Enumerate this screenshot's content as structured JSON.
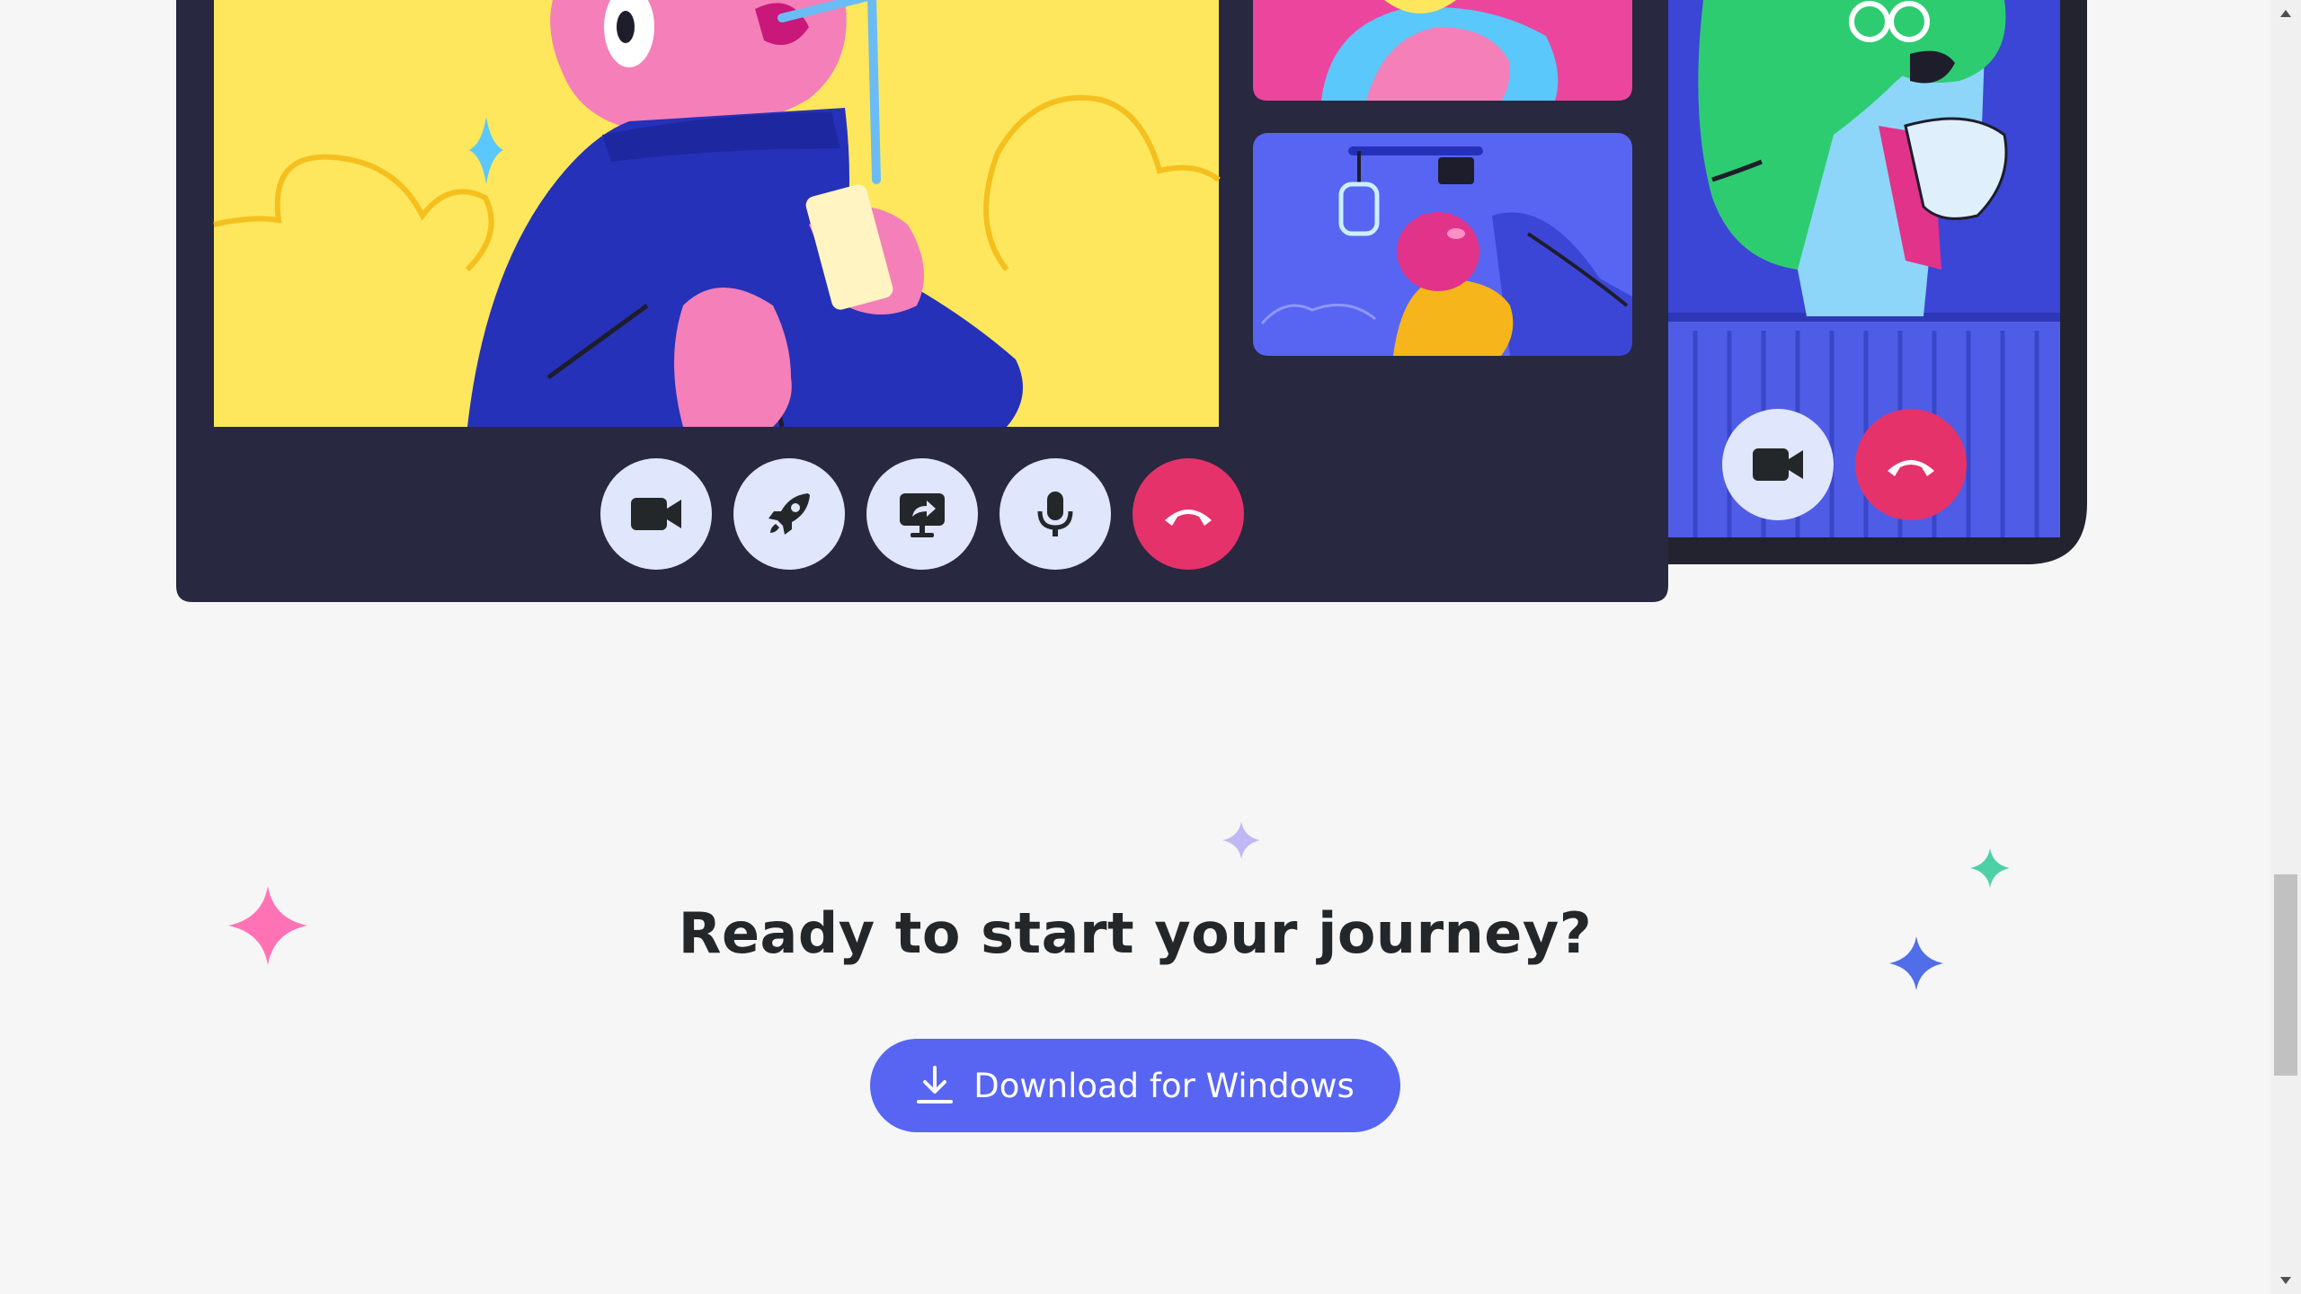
{
  "call_controls": {
    "buttons": [
      {
        "name": "video-camera-button",
        "icon": "video-camera-icon"
      },
      {
        "name": "activity-rocket-button",
        "icon": "rocket-icon"
      },
      {
        "name": "share-screen-button",
        "icon": "screen-share-icon"
      },
      {
        "name": "microphone-button",
        "icon": "microphone-icon"
      },
      {
        "name": "hang-up-button",
        "icon": "phone-hangup-icon"
      }
    ]
  },
  "mobile_controls": {
    "buttons": [
      {
        "name": "mobile-video-button",
        "icon": "video-camera-icon"
      },
      {
        "name": "mobile-hang-up-button",
        "icon": "phone-hangup-icon"
      }
    ]
  },
  "cta": {
    "title": "Ready to start your journey?",
    "download_label": "Download for Windows",
    "download_icon": "download-icon"
  },
  "colors": {
    "brand": "#5865f2",
    "hangup": "#e5326a",
    "call_frame": "#282840",
    "background": "#f6f6f6"
  }
}
